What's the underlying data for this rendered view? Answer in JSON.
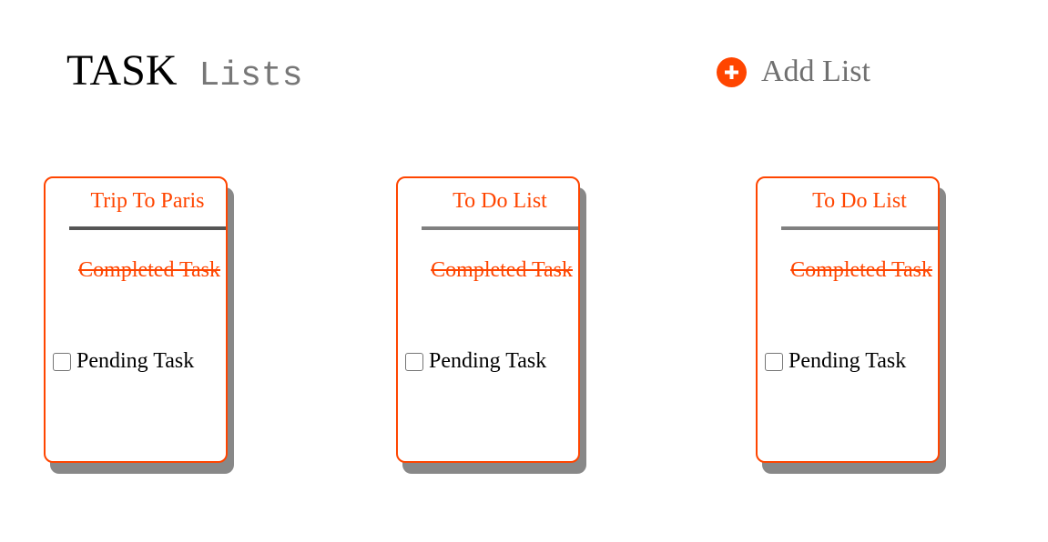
{
  "header": {
    "title_main": "TASK",
    "title_sub": "Lists",
    "add_list_label": "Add List",
    "add_icon": "plus-circle-icon"
  },
  "colors": {
    "accent": "#ff4500",
    "shadow": "#888888",
    "muted_text": "#777777"
  },
  "lists": [
    {
      "title": "Trip To Paris",
      "completed_task": "Completed Task",
      "pending_task": "Pending Task",
      "pending_checked": false
    },
    {
      "title": "To Do List",
      "completed_task": "Completed Task",
      "pending_task": "Pending Task",
      "pending_checked": false
    },
    {
      "title": "To Do List",
      "completed_task": "Completed Task",
      "pending_task": "Pending Task",
      "pending_checked": false
    }
  ]
}
